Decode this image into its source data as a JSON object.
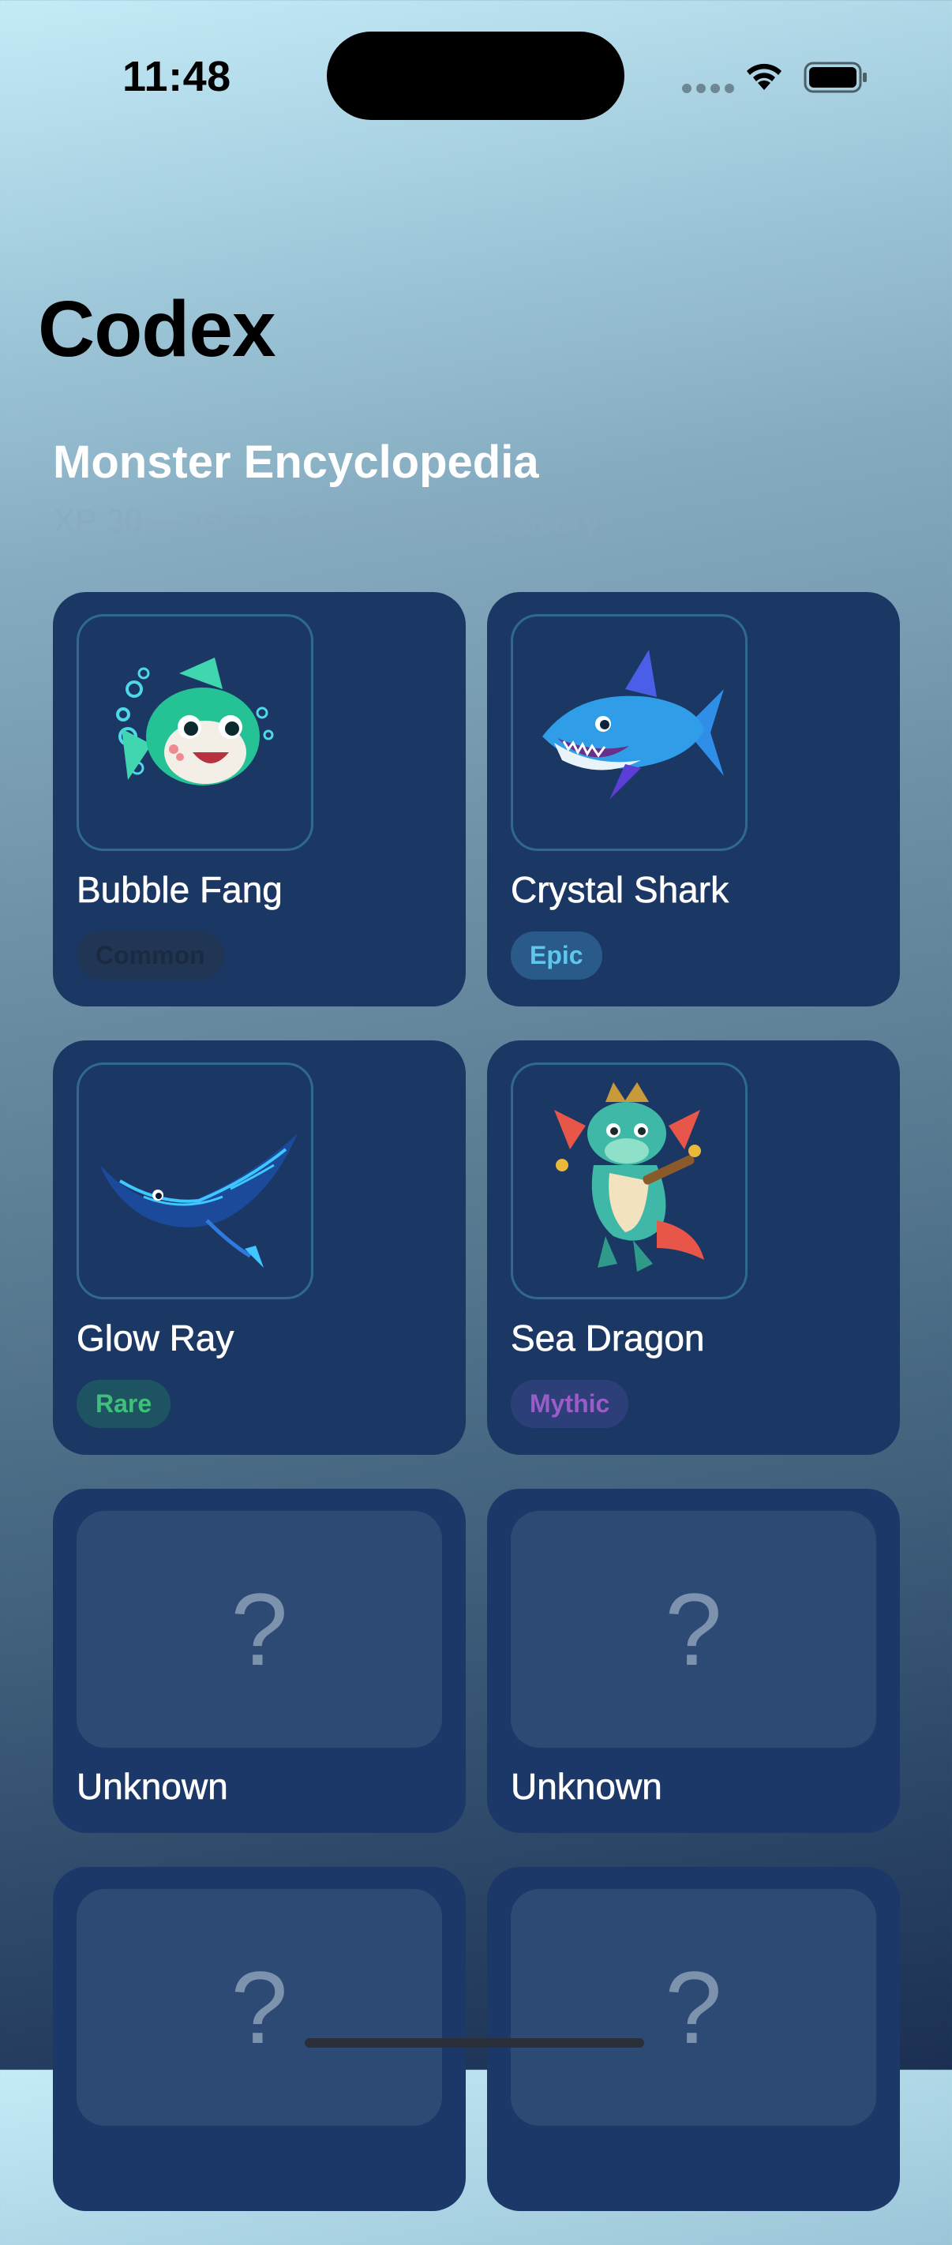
{
  "status_bar": {
    "time": "11:48"
  },
  "header": {
    "title": "Codex"
  },
  "section": {
    "title": "Monster Encyclopedia",
    "subtitle": "XP 30 — rewards for every discovery."
  },
  "monsters": [
    {
      "name": "Bubble Fang",
      "rarity": "Common",
      "discovered": true,
      "icon": "bubble-fish-icon"
    },
    {
      "name": "Crystal Shark",
      "rarity": "Epic",
      "discovered": true,
      "icon": "shark-icon"
    },
    {
      "name": "Glow Ray",
      "rarity": "Rare",
      "discovered": true,
      "icon": "manta-ray-icon"
    },
    {
      "name": "Sea Dragon",
      "rarity": "Mythic",
      "discovered": true,
      "icon": "sea-dragon-icon"
    },
    {
      "name": "Unknown",
      "discovered": false,
      "placeholder": "?"
    },
    {
      "name": "Unknown",
      "discovered": false,
      "placeholder": "?"
    },
    {
      "discovered": false,
      "placeholder": "?"
    },
    {
      "discovered": false,
      "placeholder": "?"
    }
  ],
  "colors": {
    "card_background": "#1b3764",
    "common": "#1a2a40",
    "epic": "#5fc7ee",
    "rare": "#3ec07a",
    "mythic": "#9a5cc8"
  }
}
